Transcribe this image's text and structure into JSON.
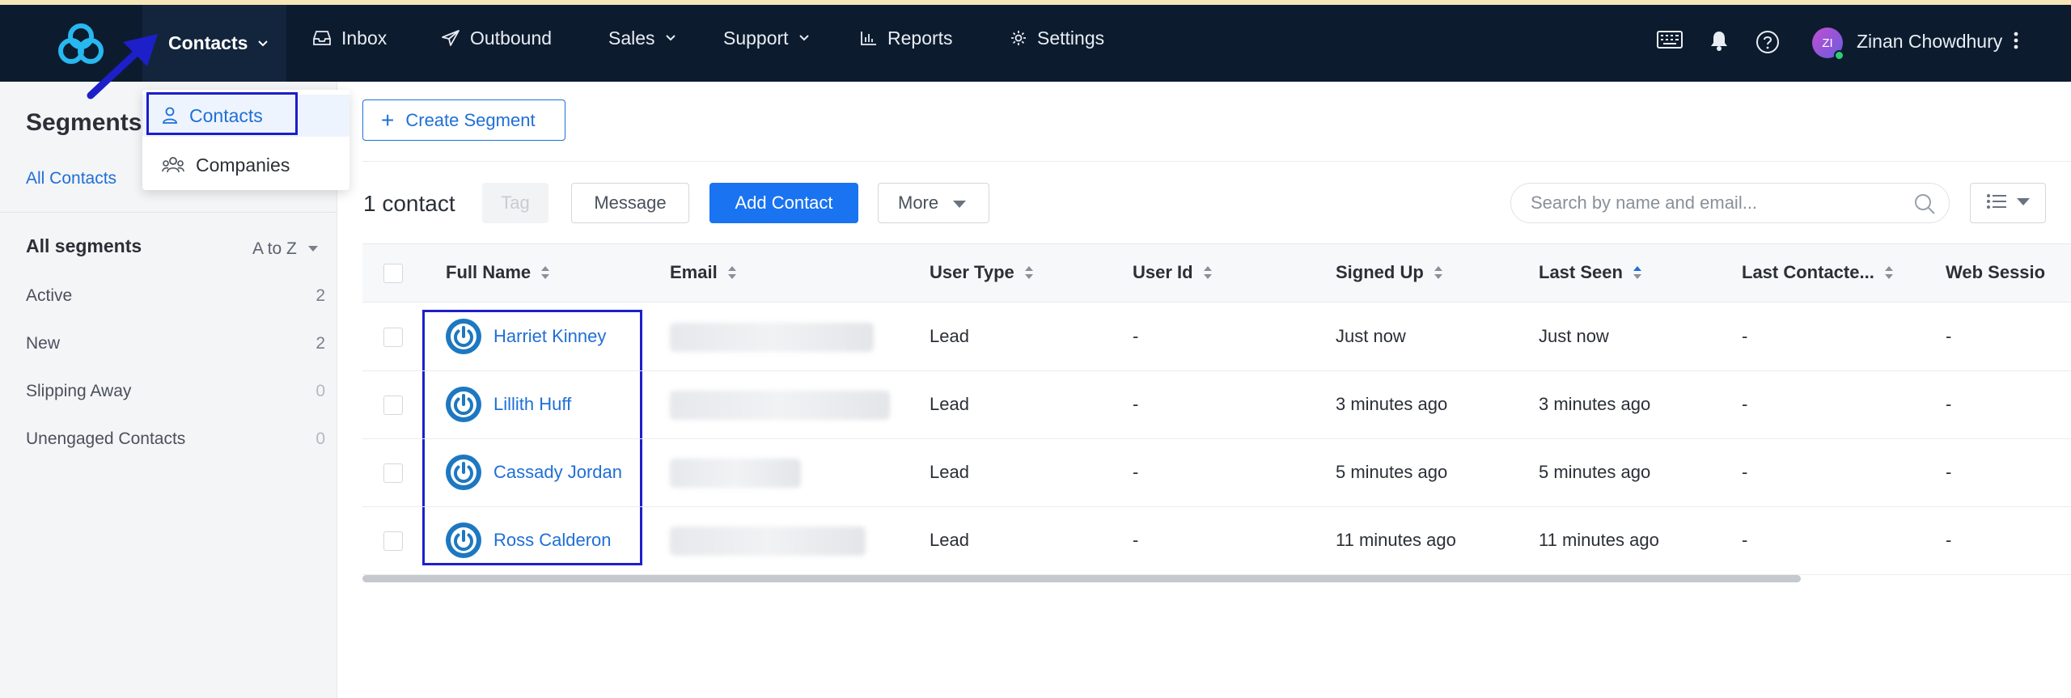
{
  "nav": {
    "items": [
      {
        "label": "Contacts",
        "icon": "none"
      },
      {
        "label": "Inbox",
        "icon": "inbox-icon"
      },
      {
        "label": "Outbound",
        "icon": "paper-plane-icon"
      },
      {
        "label": "Sales",
        "icon": "none"
      },
      {
        "label": "Support",
        "icon": "none"
      },
      {
        "label": "Reports",
        "icon": "bar-chart-icon"
      },
      {
        "label": "Settings",
        "icon": "gear-icon"
      }
    ],
    "right_icons": [
      "keyboard-icon",
      "bell-icon",
      "help-icon"
    ],
    "user": {
      "initials": "ZI",
      "name": "Zinan Chowdhury"
    },
    "colors": {
      "bar": "#0d1b2e",
      "accent": "#1a73f0",
      "highlight": "#1d1fc9"
    }
  },
  "dropdown": {
    "items": [
      {
        "label": "Contacts",
        "icon": "person-icon"
      },
      {
        "label": "Companies",
        "icon": "people-icon"
      }
    ]
  },
  "sidebar": {
    "title": "Segments",
    "all_contacts": "All Contacts",
    "all_segments": "All segments",
    "sort": "A to Z",
    "segments": [
      {
        "label": "Active",
        "count": "2"
      },
      {
        "label": "New",
        "count": "2"
      },
      {
        "label": "Slipping Away",
        "count": "0"
      },
      {
        "label": "Unengaged Contacts",
        "count": "0"
      }
    ]
  },
  "toolbar": {
    "create_segment": "Create Segment",
    "count_label": "1 contact",
    "tag": "Tag",
    "message": "Message",
    "add_contact": "Add Contact",
    "more": "More",
    "search_placeholder": "Search by name and email..."
  },
  "table": {
    "columns": [
      "Full Name",
      "Email",
      "User Type",
      "User Id",
      "Signed Up",
      "Last Seen",
      "Last Contacte...",
      "Web Sessio"
    ],
    "rows": [
      {
        "name": "Harriet Kinney",
        "user_type": "Lead",
        "user_id": "-",
        "signed_up": "Just now",
        "last_seen": "Just now",
        "last_contacted": "-",
        "web_sessions": "-"
      },
      {
        "name": "Lillith Huff",
        "user_type": "Lead",
        "user_id": "-",
        "signed_up": "3 minutes ago",
        "last_seen": "3 minutes ago",
        "last_contacted": "-",
        "web_sessions": "-"
      },
      {
        "name": "Cassady Jordan",
        "user_type": "Lead",
        "user_id": "-",
        "signed_up": "5 minutes ago",
        "last_seen": "5 minutes ago",
        "last_contacted": "-",
        "web_sessions": "-"
      },
      {
        "name": "Ross Calderon",
        "user_type": "Lead",
        "user_id": "-",
        "signed_up": "11 minutes ago",
        "last_seen": "11 minutes ago",
        "last_contacted": "-",
        "web_sessions": "-"
      }
    ]
  }
}
